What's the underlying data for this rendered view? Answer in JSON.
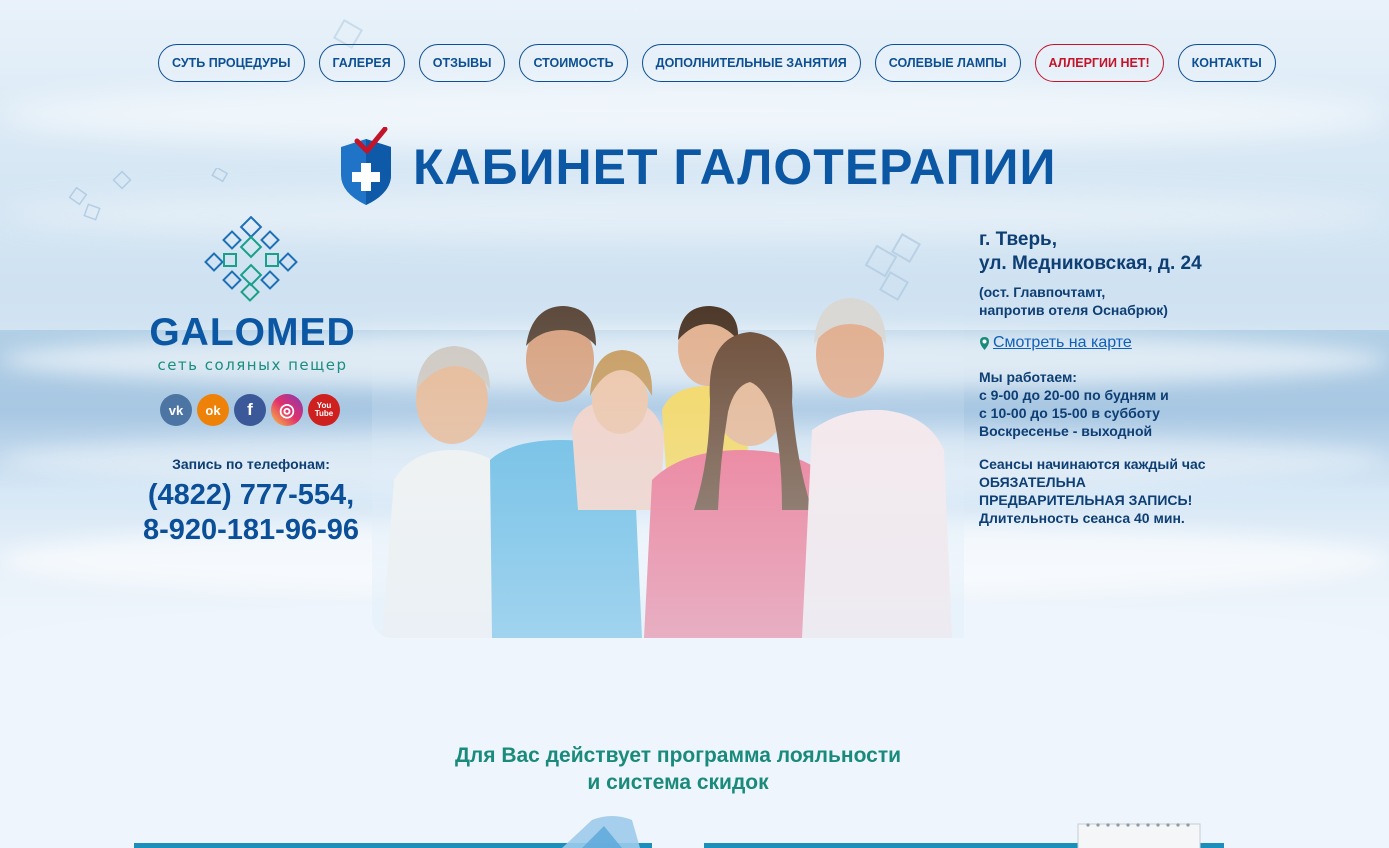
{
  "nav": {
    "items": [
      {
        "label": "СУТЬ ПРОЦЕДУРЫ"
      },
      {
        "label": "ГАЛЕРЕЯ"
      },
      {
        "label": "ОТЗЫВЫ"
      },
      {
        "label": "СТОИМОСТЬ"
      },
      {
        "label": "ДОПОЛНИТЕЛЬНЫЕ ЗАНЯТИЯ"
      },
      {
        "label": "СОЛЕВЫЕ ЛАМПЫ"
      },
      {
        "label": "АЛЛЕРГИИ НЕТ!"
      },
      {
        "label": "КОНТАКТЫ"
      }
    ]
  },
  "header": {
    "title": "КАБИНЕТ ГАЛОТЕРАПИИ"
  },
  "brand": {
    "name": "GALOMED",
    "tagline": "сеть соляных пещер"
  },
  "socials": [
    {
      "icon": "vk-icon",
      "glyph": "vk",
      "color": "#4c75a3"
    },
    {
      "icon": "odnoklassniki-icon",
      "glyph": "ok",
      "color": "#ee8208"
    },
    {
      "icon": "facebook-icon",
      "glyph": "f",
      "color": "#3b5998"
    },
    {
      "icon": "instagram-icon",
      "glyph": "◎",
      "color": "#c13584"
    },
    {
      "icon": "youtube-icon",
      "glyph": "You Tube",
      "color": "#cd201f"
    }
  ],
  "contacts": {
    "phones_label": "Запись по телефонам:",
    "phone1": "(4822) 777-554,",
    "phone2": "8-920-181-96-96"
  },
  "address": {
    "city": "г. Тверь,",
    "street": "ул. Медниковская, д. 24",
    "note1": "(ост. Главпочтамт,",
    "note2": "напротив отеля Оснабрюк)",
    "map_link": "Смотреть на карте"
  },
  "schedule": {
    "heading": "Мы работаем:",
    "line1": "с 9-00 до 20-00 по будням и",
    "line2": "с 10-00 до 15-00 в субботу",
    "line3": "Воскресенье - выходной"
  },
  "sessions": {
    "line1": "Сеансы начинаются каждый час",
    "line2": "ОБЯЗАТЕЛЬНА",
    "line3": "ПРЕДВАРИТЕЛЬНАЯ ЗАПИСЬ!",
    "line4": "Длительность сеанса 40 мин."
  },
  "loyalty": {
    "line1": "Для Вас действует программа лояльности",
    "line2": "и система скидок"
  },
  "colors": {
    "accent": "#0b57a4",
    "alert": "#c3142a",
    "teal": "#1a8a7c"
  }
}
